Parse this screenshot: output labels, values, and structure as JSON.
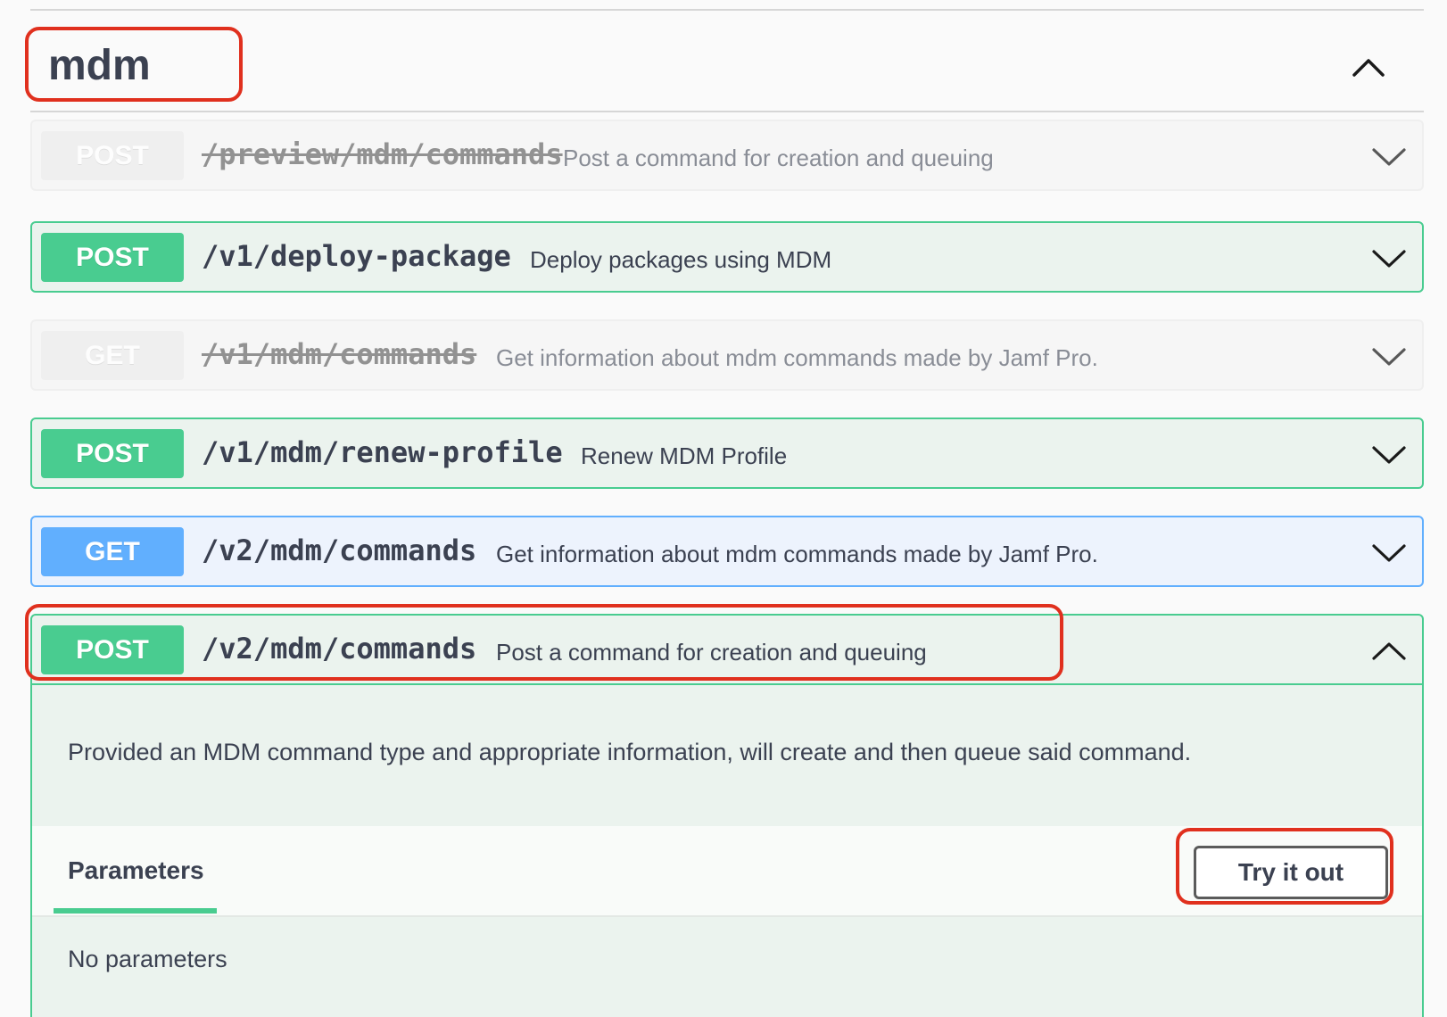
{
  "tag": {
    "title": "mdm",
    "toggle_icon": "chevron-up-icon"
  },
  "operations": [
    {
      "method": "POST",
      "path": "/preview/mdm/commands",
      "summary": "Post a command for creation and queuing",
      "deprecated": true,
      "expanded": false
    },
    {
      "method": "POST",
      "path": "/v1/deploy-package",
      "summary": "Deploy packages using MDM",
      "deprecated": false,
      "expanded": false
    },
    {
      "method": "GET",
      "path": "/v1/mdm/commands",
      "summary": "Get information about mdm commands made by Jamf Pro.",
      "deprecated": true,
      "expanded": false
    },
    {
      "method": "POST",
      "path": "/v1/mdm/renew-profile",
      "summary": "Renew MDM Profile",
      "deprecated": false,
      "expanded": false
    },
    {
      "method": "GET",
      "path": "/v2/mdm/commands",
      "summary": "Get information about mdm commands made by Jamf Pro.",
      "deprecated": false,
      "expanded": false
    },
    {
      "method": "POST",
      "path": "/v2/mdm/commands",
      "summary": "Post a command for creation and queuing",
      "deprecated": false,
      "expanded": true
    }
  ],
  "expanded_operation": {
    "description": "Provided an MDM command type and appropriate information, will create and then queue said command.",
    "parameters_tab": "Parameters",
    "try_button": "Try it out",
    "no_parameters": "No parameters"
  },
  "colors": {
    "post": "#49cc90",
    "get": "#61affe",
    "deprecated": "#ebebeb",
    "highlight": "#e0301e"
  }
}
